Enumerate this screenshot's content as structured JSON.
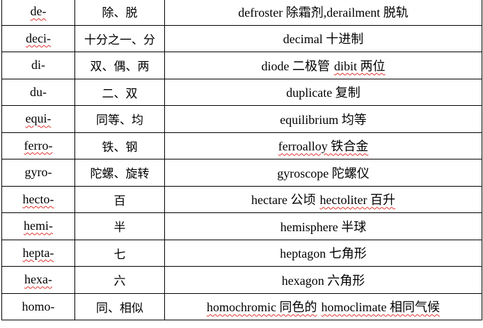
{
  "rows": [
    {
      "prefix": "de-",
      "meaning": "除、脱",
      "example": "defroster 除霜剂,derailment 脱轨"
    },
    {
      "prefix": "deci-",
      "meaning": "十分之一、分",
      "example": "decimal 十进制"
    },
    {
      "prefix": "di-",
      "meaning": "双、偶、两",
      "example": "diode 二极管",
      "example2": "dibit 两位"
    },
    {
      "prefix": "du-",
      "meaning": "二、双",
      "example": "duplicate 复制"
    },
    {
      "prefix": "equi-",
      "meaning": "同等、均",
      "example": "equilibrium 均等"
    },
    {
      "prefix": "ferro-",
      "meaning": "铁、钢",
      "example": "ferroalloy 铁合金"
    },
    {
      "prefix": "gyro-",
      "meaning": "陀螺、旋转",
      "example": "gyroscope 陀螺仪"
    },
    {
      "prefix": "hecto-",
      "meaning": "百",
      "example": "hectare 公顷",
      "example2": "hectoliter 百升"
    },
    {
      "prefix": "hemi-",
      "meaning": "半",
      "example": "hemisphere 半球"
    },
    {
      "prefix": "hepta-",
      "meaning": "七",
      "example": "heptagon 七角形"
    },
    {
      "prefix": "hexa-",
      "meaning": "六",
      "example": "hexagon 六角形"
    },
    {
      "prefix": "homo-",
      "meaning": "同、相似",
      "example": "homochromic 同色的",
      "example2": "homoclimate 相同气候"
    }
  ]
}
